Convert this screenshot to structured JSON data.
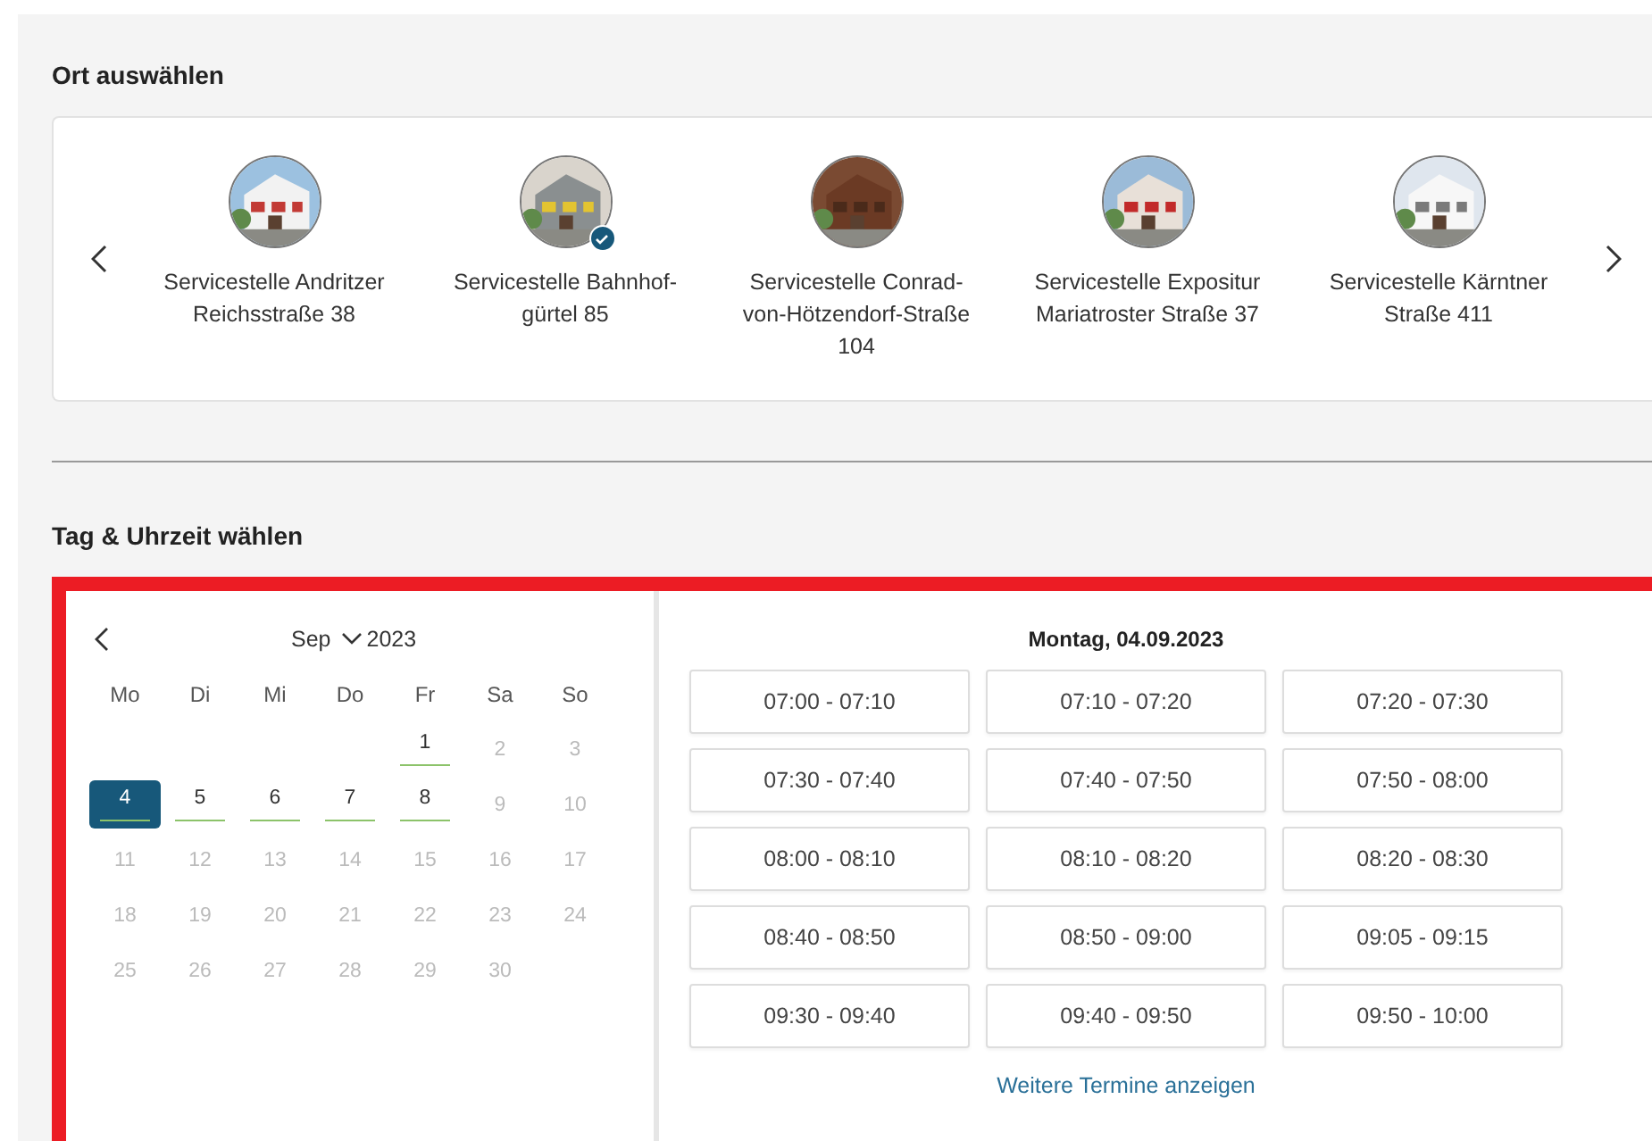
{
  "location_section": {
    "title": "Ort auswählen",
    "locations": [
      {
        "name": "Servicestelle Andritzer Reichsstraße 38",
        "selected": false
      },
      {
        "name": "Servicestelle Bahnhof-gürtel 85",
        "selected": true
      },
      {
        "name": "Servicestelle Conrad-von-Hötzendorf-Straße 104",
        "selected": false
      },
      {
        "name": "Servicestelle Expositur Mariatroster Straße 37",
        "selected": false
      },
      {
        "name": "Servicestelle Kärntner Straße 411",
        "selected": false
      }
    ]
  },
  "time_section": {
    "title": "Tag & Uhrzeit wählen",
    "calendar": {
      "month": "Sep",
      "year": "2023",
      "weekdays": [
        "Mo",
        "Di",
        "Mi",
        "Do",
        "Fr",
        "Sa",
        "So"
      ],
      "days": [
        {
          "label": "1",
          "disabled": false,
          "selected": false
        },
        {
          "label": "2",
          "disabled": true,
          "selected": false
        },
        {
          "label": "3",
          "disabled": true,
          "selected": false
        },
        {
          "label": "4",
          "disabled": false,
          "selected": true
        },
        {
          "label": "5",
          "disabled": false,
          "selected": false
        },
        {
          "label": "6",
          "disabled": false,
          "selected": false
        },
        {
          "label": "7",
          "disabled": false,
          "selected": false
        },
        {
          "label": "8",
          "disabled": false,
          "selected": false
        },
        {
          "label": "9",
          "disabled": true,
          "selected": false
        },
        {
          "label": "10",
          "disabled": true,
          "selected": false
        },
        {
          "label": "11",
          "disabled": true,
          "selected": false
        },
        {
          "label": "12",
          "disabled": true,
          "selected": false
        },
        {
          "label": "13",
          "disabled": true,
          "selected": false
        },
        {
          "label": "14",
          "disabled": true,
          "selected": false
        },
        {
          "label": "15",
          "disabled": true,
          "selected": false
        },
        {
          "label": "16",
          "disabled": true,
          "selected": false
        },
        {
          "label": "17",
          "disabled": true,
          "selected": false
        },
        {
          "label": "18",
          "disabled": true,
          "selected": false
        },
        {
          "label": "19",
          "disabled": true,
          "selected": false
        },
        {
          "label": "20",
          "disabled": true,
          "selected": false
        },
        {
          "label": "21",
          "disabled": true,
          "selected": false
        },
        {
          "label": "22",
          "disabled": true,
          "selected": false
        },
        {
          "label": "23",
          "disabled": true,
          "selected": false
        },
        {
          "label": "24",
          "disabled": true,
          "selected": false
        },
        {
          "label": "25",
          "disabled": true,
          "selected": false
        },
        {
          "label": "26",
          "disabled": true,
          "selected": false
        },
        {
          "label": "27",
          "disabled": true,
          "selected": false
        },
        {
          "label": "28",
          "disabled": true,
          "selected": false
        },
        {
          "label": "29",
          "disabled": true,
          "selected": false
        },
        {
          "label": "30",
          "disabled": true,
          "selected": false
        }
      ]
    },
    "date_heading": "Montag, 04.09.2023",
    "slots": [
      "07:00 - 07:10",
      "07:10 - 07:20",
      "07:20 - 07:30",
      "07:30 - 07:40",
      "07:40 - 07:50",
      "07:50 - 08:00",
      "08:00 - 08:10",
      "08:10 - 08:20",
      "08:20 - 08:30",
      "08:40 - 08:50",
      "08:50 - 09:00",
      "09:05 - 09:15",
      "09:30 - 09:40",
      "09:40 - 09:50",
      "09:50 - 10:00"
    ],
    "more_link": "Weitere Termine anzeigen"
  }
}
